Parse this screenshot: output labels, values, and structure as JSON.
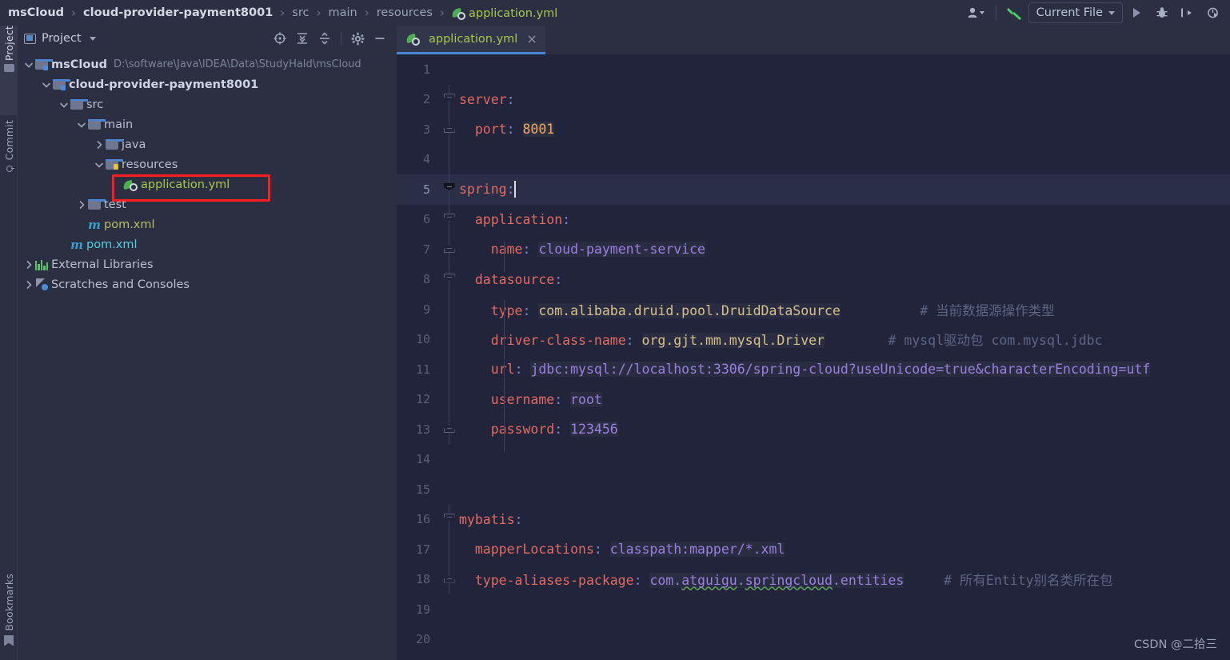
{
  "breadcrumb": {
    "items": [
      {
        "label": "msCloud",
        "style": "bold"
      },
      {
        "label": "cloud-provider-payment8001",
        "style": "bold"
      },
      {
        "label": "src",
        "style": "dim"
      },
      {
        "label": "main",
        "style": "dim"
      },
      {
        "label": "resources",
        "style": "dim"
      },
      {
        "label": "application.yml",
        "style": "file"
      }
    ],
    "separator": "›"
  },
  "toolbar": {
    "user_icon": "user-avatar-icon",
    "build_icon": "build-hammer-icon",
    "run_config_label": "Current File",
    "run_icon": "run-play-icon",
    "debug_icon": "debug-bug-icon",
    "run_with_coverage_icon": "run-coverage-icon",
    "profiler_icon": "profiler-icon"
  },
  "tool_stripe": {
    "left_top": [
      {
        "label": "Project",
        "icon": "project-folder-icon",
        "active": true
      },
      {
        "label": "Commit",
        "icon": "commit-icon",
        "active": false
      }
    ],
    "left_bottom": [
      {
        "label": "Bookmarks",
        "icon": "bookmark-icon",
        "active": false
      }
    ]
  },
  "project_panel": {
    "title": "Project",
    "title_caret": "▾",
    "tools": [
      {
        "name": "select-opened-file-icon"
      },
      {
        "name": "expand-all-icon"
      },
      {
        "name": "collapse-all-icon"
      },
      {
        "name": "settings-gear-icon"
      },
      {
        "name": "hide-panel-icon"
      }
    ],
    "tree": [
      {
        "label": "msCloud",
        "path": "D:\\software\\Java\\IDEA\\Data\\StudyHald\\msCloud",
        "indent": 0,
        "arrow": "down",
        "icon": "module-folder-icon",
        "bold": true,
        "color": "default"
      },
      {
        "label": "cloud-provider-payment8001",
        "path": "",
        "indent": 1,
        "arrow": "down",
        "icon": "module-folder-icon",
        "bold": true,
        "color": "default"
      },
      {
        "label": "src",
        "path": "",
        "indent": 2,
        "arrow": "down",
        "icon": "folder-icon",
        "bold": false,
        "color": "default"
      },
      {
        "label": "main",
        "path": "",
        "indent": 3,
        "arrow": "down",
        "icon": "folder-icon",
        "bold": false,
        "color": "default"
      },
      {
        "label": "java",
        "path": "",
        "indent": 4,
        "arrow": "right",
        "icon": "folder-icon",
        "bold": false,
        "color": "default"
      },
      {
        "label": "resources",
        "path": "",
        "indent": 4,
        "arrow": "down",
        "icon": "resources-folder-icon",
        "bold": false,
        "color": "default"
      },
      {
        "label": "application.yml",
        "path": "",
        "indent": 5,
        "arrow": "none",
        "icon": "spring-yaml-icon",
        "bold": false,
        "color": "yml",
        "highlighted": true
      },
      {
        "label": "test",
        "path": "",
        "indent": 3,
        "arrow": "right",
        "icon": "folder-icon",
        "bold": false,
        "color": "default"
      },
      {
        "label": "pom.xml",
        "path": "",
        "indent": 3,
        "arrow": "none",
        "icon": "maven-icon",
        "bold": false,
        "color": "pomA"
      },
      {
        "label": "pom.xml",
        "path": "",
        "indent": 2,
        "arrow": "none",
        "icon": "maven-icon",
        "bold": false,
        "color": "pomB"
      },
      {
        "label": "External Libraries",
        "path": "",
        "indent": 0,
        "arrow": "right",
        "icon": "libraries-icon",
        "bold": false,
        "color": "default"
      },
      {
        "label": "Scratches and Consoles",
        "path": "",
        "indent": 0,
        "arrow": "right",
        "icon": "scratches-icon",
        "bold": false,
        "color": "default"
      }
    ]
  },
  "editor": {
    "tab": {
      "name": "application.yml",
      "icon": "spring-yaml-icon",
      "close": "×",
      "active": true
    },
    "current_line": 5,
    "lines": [
      {
        "n": 1,
        "fold": "none",
        "indent_guides": [],
        "tokens": []
      },
      {
        "n": 2,
        "fold": "open",
        "indent_guides": [],
        "tokens": [
          {
            "t": "server",
            "c": "k"
          },
          {
            "t": ":",
            "c": "c"
          }
        ]
      },
      {
        "n": 3,
        "fold": "close",
        "indent_guides": [],
        "tokens": [
          {
            "t": "  ",
            "c": "p"
          },
          {
            "t": "port",
            "c": "k"
          },
          {
            "t": ":",
            "c": "c"
          },
          {
            "t": " ",
            "c": "p"
          },
          {
            "t": "8001",
            "c": "num"
          }
        ]
      },
      {
        "n": 4,
        "fold": "none",
        "indent_guides": [],
        "tokens": []
      },
      {
        "n": 5,
        "fold": "open",
        "indent_guides": [],
        "tokens": [
          {
            "t": "spring",
            "c": "k"
          },
          {
            "t": ":",
            "c": "c"
          },
          {
            "t": "",
            "c": "cursor"
          }
        ]
      },
      {
        "n": 6,
        "fold": "open",
        "indent_guides": [],
        "tokens": [
          {
            "t": "  ",
            "c": "p"
          },
          {
            "t": "application",
            "c": "k"
          },
          {
            "t": ":",
            "c": "c"
          }
        ]
      },
      {
        "n": 7,
        "fold": "close",
        "indent_guides": [
          56
        ],
        "tokens": [
          {
            "t": "    ",
            "c": "p"
          },
          {
            "t": "name",
            "c": "k"
          },
          {
            "t": ":",
            "c": "c"
          },
          {
            "t": " ",
            "c": "p"
          },
          {
            "t": "cloud-payment-service",
            "c": "vpurple"
          }
        ]
      },
      {
        "n": 8,
        "fold": "open",
        "indent_guides": [],
        "tokens": [
          {
            "t": "  ",
            "c": "p"
          },
          {
            "t": "datasource",
            "c": "k"
          },
          {
            "t": ":",
            "c": "c"
          }
        ]
      },
      {
        "n": 9,
        "fold": "none",
        "indent_guides": [
          56
        ],
        "tokens": [
          {
            "t": "    ",
            "c": "p"
          },
          {
            "t": "type",
            "c": "k"
          },
          {
            "t": ":",
            "c": "c"
          },
          {
            "t": " ",
            "c": "p"
          },
          {
            "t": "com.alibaba.druid.pool.DruidDataSource",
            "c": "vtan"
          },
          {
            "t": "          ",
            "c": "p"
          },
          {
            "t": "# 当前数据源操作类型",
            "c": "cmt"
          }
        ]
      },
      {
        "n": 10,
        "fold": "none",
        "indent_guides": [
          56
        ],
        "tokens": [
          {
            "t": "    ",
            "c": "p"
          },
          {
            "t": "driver-class-name",
            "c": "k"
          },
          {
            "t": ":",
            "c": "c"
          },
          {
            "t": " ",
            "c": "p"
          },
          {
            "t": "org.gjt.mm.mysql.Driver",
            "c": "vtan"
          },
          {
            "t": "        ",
            "c": "p"
          },
          {
            "t": "# mysql驱动包 com.mysql.jdbc",
            "c": "cmt"
          }
        ]
      },
      {
        "n": 11,
        "fold": "none",
        "indent_guides": [
          56
        ],
        "tokens": [
          {
            "t": "    ",
            "c": "p"
          },
          {
            "t": "url",
            "c": "k"
          },
          {
            "t": ":",
            "c": "c"
          },
          {
            "t": " ",
            "c": "p"
          },
          {
            "t": "jdbc:mysql://localhost:3306/spring-cloud?useUnicode=true&characterEncoding=utf",
            "c": "vpurple"
          }
        ]
      },
      {
        "n": 12,
        "fold": "none",
        "indent_guides": [
          56
        ],
        "tokens": [
          {
            "t": "    ",
            "c": "p"
          },
          {
            "t": "username",
            "c": "k"
          },
          {
            "t": ":",
            "c": "c"
          },
          {
            "t": " ",
            "c": "p"
          },
          {
            "t": "root",
            "c": "vpurple"
          }
        ]
      },
      {
        "n": 13,
        "fold": "close",
        "indent_guides": [
          56
        ],
        "tokens": [
          {
            "t": "    ",
            "c": "p"
          },
          {
            "t": "password",
            "c": "k"
          },
          {
            "t": ":",
            "c": "c"
          },
          {
            "t": " ",
            "c": "p"
          },
          {
            "t": "123456",
            "c": "vpurple"
          }
        ]
      },
      {
        "n": 14,
        "fold": "none",
        "indent_guides": [],
        "tokens": []
      },
      {
        "n": 15,
        "fold": "none",
        "indent_guides": [],
        "tokens": []
      },
      {
        "n": 16,
        "fold": "open",
        "indent_guides": [],
        "tokens": [
          {
            "t": "mybatis",
            "c": "k"
          },
          {
            "t": ":",
            "c": "c"
          }
        ]
      },
      {
        "n": 17,
        "fold": "none",
        "indent_guides": [],
        "tokens": [
          {
            "t": "  ",
            "c": "p"
          },
          {
            "t": "mapperLocations",
            "c": "k"
          },
          {
            "t": ":",
            "c": "c"
          },
          {
            "t": " ",
            "c": "p"
          },
          {
            "t": "classpath:mapper/*.xml",
            "c": "vpurple"
          }
        ]
      },
      {
        "n": 18,
        "fold": "close",
        "indent_guides": [],
        "tokens": [
          {
            "t": "  ",
            "c": "p"
          },
          {
            "t": "type-aliases-package",
            "c": "k"
          },
          {
            "t": ":",
            "c": "c"
          },
          {
            "t": " ",
            "c": "p"
          },
          {
            "t": "com.",
            "c": "vpurple"
          },
          {
            "t": "atguigu",
            "c": "vpurple sq"
          },
          {
            "t": ".",
            "c": "vpurple"
          },
          {
            "t": "springcloud",
            "c": "vpurple sq"
          },
          {
            "t": ".entities",
            "c": "vpurple"
          },
          {
            "t": "     ",
            "c": "p"
          },
          {
            "t": "# 所有Entity别名类所在包",
            "c": "cmt"
          }
        ]
      },
      {
        "n": 19,
        "fold": "none",
        "indent_guides": [],
        "tokens": []
      },
      {
        "n": 20,
        "fold": "none",
        "indent_guides": [],
        "tokens": []
      }
    ]
  },
  "watermark": "CSDN @二拾三",
  "colors": {
    "accent_blue": "#4a88d6",
    "annotation_red": "#fb1f1f",
    "yaml_key": "#e06c62",
    "yaml_value_purple": "#9a7fe0",
    "yaml_value_tan": "#d6c08a",
    "yaml_number": "#f0a868",
    "comment": "#5e6682",
    "file_green": "#a7c94c"
  }
}
